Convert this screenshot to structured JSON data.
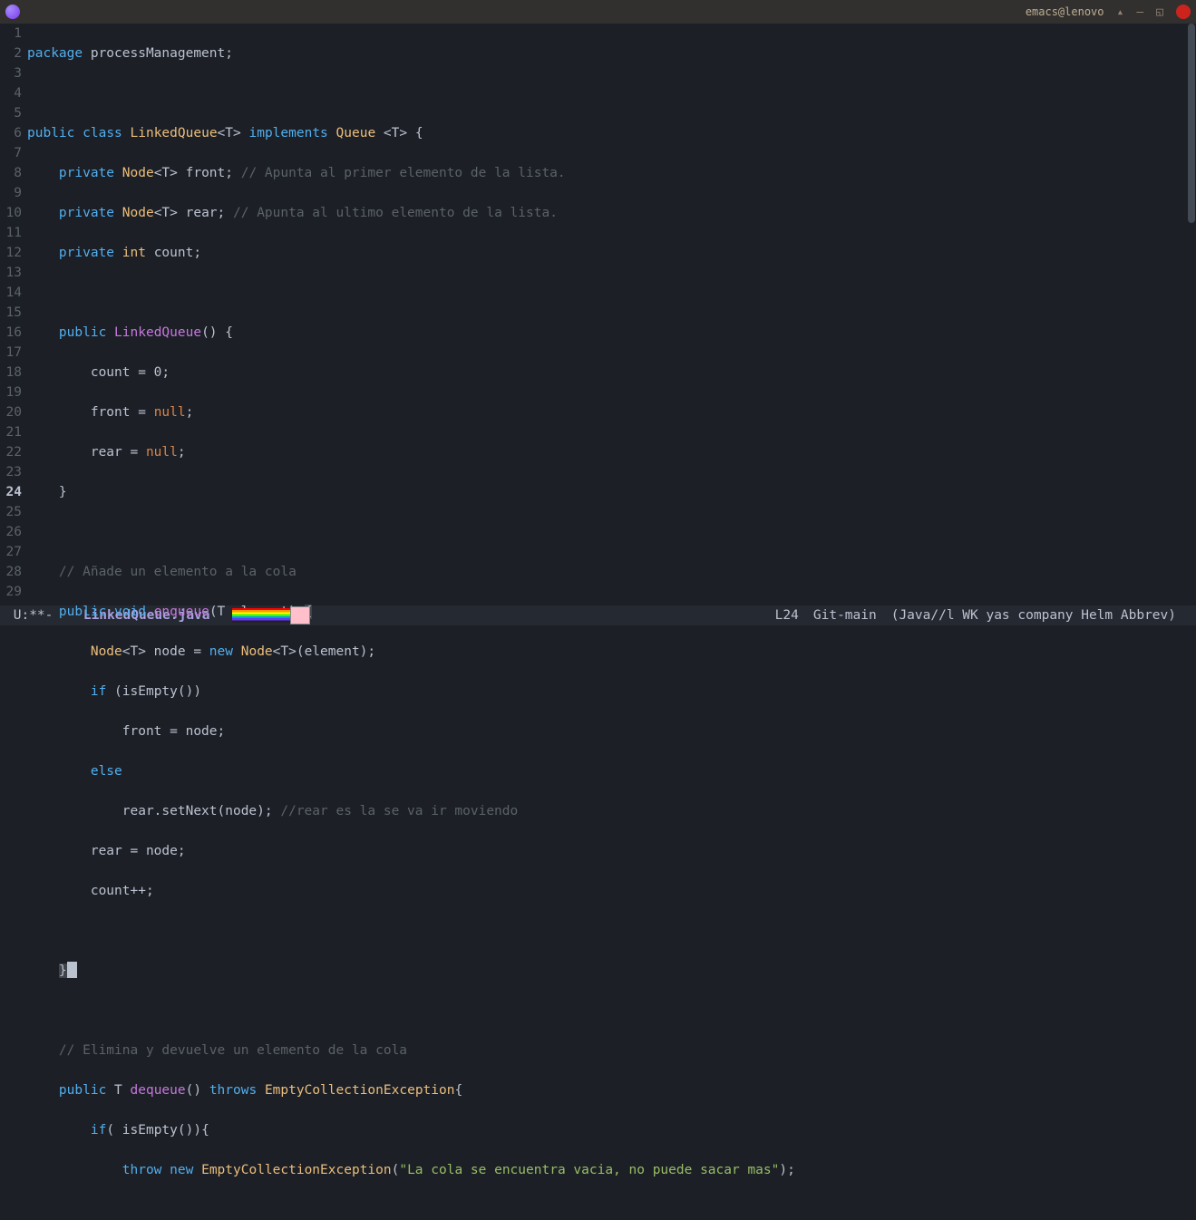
{
  "window": {
    "title": "emacs@lenovo"
  },
  "gutter": [
    "1",
    "2",
    "3",
    "4",
    "5",
    "6",
    "7",
    "8",
    "9",
    "10",
    "11",
    "12",
    "13",
    "14",
    "15",
    "16",
    "17",
    "18",
    "19",
    "20",
    "21",
    "22",
    "23",
    "24",
    "25",
    "26",
    "27",
    "28",
    "29"
  ],
  "current_line_index": 23,
  "code": {
    "l1": {
      "kw1": "package",
      "id": " processManagement;"
    },
    "l3": {
      "kw1": "public",
      "kw2": "class",
      "cls": "LinkedQueue",
      "gen1": "<T>",
      "kw3": "implements",
      "iface": "Queue",
      "gen2": " <T> {"
    },
    "l4": {
      "ind": "    ",
      "kw1": "private",
      "type": "Node",
      "rest": "<T> front; ",
      "cmt": "// Apunta al primer elemento de la lista."
    },
    "l5": {
      "ind": "    ",
      "kw1": "private",
      "type": "Node",
      "rest": "<T> rear; ",
      "cmt": "// Apunta al ultimo elemento de la lista."
    },
    "l6": {
      "ind": "    ",
      "kw1": "private",
      "type": "int",
      "rest": " count;"
    },
    "l8": {
      "ind": "    ",
      "kw1": "public",
      "fn": "LinkedQueue",
      "rest": "() {"
    },
    "l9": {
      "txt": "        count = 0;"
    },
    "l10": {
      "ind": "        front = ",
      "const": "null",
      "rest": ";"
    },
    "l11": {
      "ind": "        rear = ",
      "const": "null",
      "rest": ";"
    },
    "l12": {
      "txt": "    }"
    },
    "l14": {
      "ind": "    ",
      "cmt": "// Añade un elemento a la cola"
    },
    "l15": {
      "ind": "    ",
      "kw1": "public",
      "kw2": "void",
      "fn": "enqueue",
      "args": "(T element) ",
      "brace": "{"
    },
    "l16": {
      "ind": "        ",
      "type1": "Node",
      "mid1": "<T> node = ",
      "kw1": "new",
      "type2": " Node",
      "rest": "<T>(element);"
    },
    "l17": {
      "ind": "        ",
      "kw1": "if",
      "rest": " (isEmpty())"
    },
    "l18": {
      "txt": "            front = node;"
    },
    "l19": {
      "ind": "        ",
      "kw1": "else"
    },
    "l20": {
      "ind": "            rear.setNext(node); ",
      "cmt": "//rear es la se va ir moviendo"
    },
    "l21": {
      "txt": "        rear = node;"
    },
    "l22": {
      "txt": "        count++;"
    },
    "l24": {
      "ind": "    ",
      "brace": "}"
    },
    "l26": {
      "ind": "    ",
      "cmt": "// Elimina y devuelve un elemento de la cola"
    },
    "l27": {
      "ind": "    ",
      "kw1": "public",
      "mid": " T ",
      "fn": "dequeue",
      "rest1": "() ",
      "kw2": "throws",
      "type": " EmptyCollectionException",
      "rest2": "{"
    },
    "l28": {
      "ind": "        ",
      "kw1": "if",
      "rest": "( isEmpty()){"
    },
    "l29": {
      "ind": "            ",
      "kw1": "throw",
      "kw2": "new",
      "type": "EmptyCollectionException",
      "paren": "(",
      "str": "\"La cola se encuentra vacia, no puede sacar mas\"",
      "rest": ");"
    }
  },
  "modeline": {
    "status": " U:**- ",
    "file": " LinkedQueue.java ",
    "pos": "L24",
    "vcs": "Git-main",
    "modes": "(Java//l WK yas company Helm Abbrev)"
  }
}
